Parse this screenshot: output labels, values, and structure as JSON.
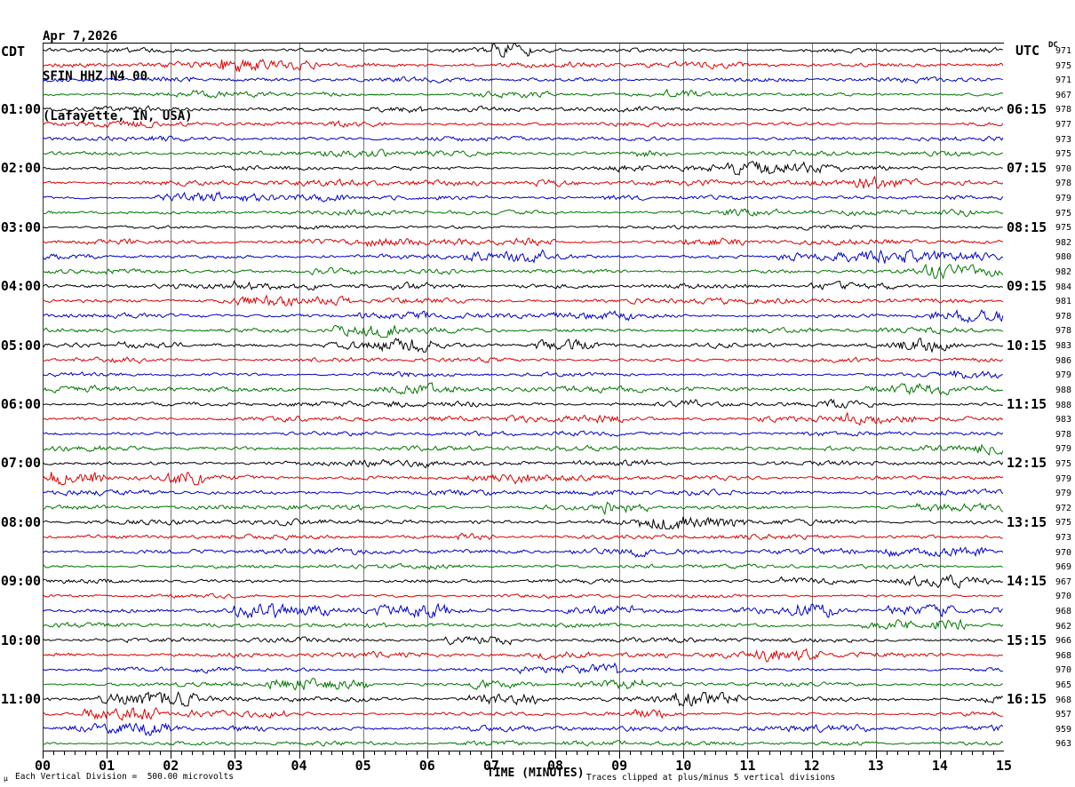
{
  "header": {
    "date_line": "Apr 7,2026",
    "station_line": "SFIN HHZ N4 00",
    "location_line": "(Lafayette, IN, USA)"
  },
  "axis_labels": {
    "left_tz": "CDT",
    "right_tz": "UTC",
    "dc": "DC",
    "x_title": "TIME (MINUTES)"
  },
  "left_times": [
    "01:00",
    "02:00",
    "03:00",
    "04:00",
    "05:00",
    "06:00",
    "07:00",
    "08:00",
    "09:00",
    "10:00",
    "11:00"
  ],
  "right_times": [
    "06:15",
    "07:15",
    "08:15",
    "09:15",
    "10:15",
    "11:15",
    "12:15",
    "13:15",
    "14:15",
    "15:15",
    "16:15"
  ],
  "x_ticks": [
    "00",
    "01",
    "02",
    "03",
    "04",
    "05",
    "06",
    "07",
    "08",
    "09",
    "10",
    "11",
    "12",
    "13",
    "14",
    "15"
  ],
  "dc_values": [
    971,
    975,
    971,
    967,
    978,
    977,
    973,
    975,
    970,
    978,
    979,
    975,
    975,
    982,
    980,
    982,
    984,
    981,
    978,
    978,
    983,
    986,
    979,
    988,
    988,
    983,
    978,
    979,
    975,
    979,
    979,
    972,
    975,
    973,
    970,
    969,
    967,
    970,
    968,
    962,
    966,
    968,
    970,
    965,
    968,
    957,
    959,
    963
  ],
  "footer": {
    "micro_glyph": "µ",
    "scale_note": "Each Vertical Division =  500.00 microvolts",
    "clip_note": "Traces clipped at plus/minus 5 vertical divisions"
  },
  "colors": {
    "trace_cycle": [
      "#000000",
      "#dd0000",
      "#0000cc",
      "#007700"
    ],
    "grid": "#777777",
    "frame": "#303030",
    "text": "#000000"
  },
  "chart_data": {
    "type": "line",
    "subtype": "helicorder-seismogram",
    "title": "SFIN HHZ N4 00 (Lafayette, IN, USA) Apr 7,2026",
    "xlabel": "TIME (MINUTES)",
    "x_range_minutes": [
      0,
      15
    ],
    "minutes_per_row": 15,
    "rows": 48,
    "rows_per_hour": 4,
    "minor_ticks_per_minute": 6,
    "grid": "vertical gray line at each minute, 00 through 15",
    "trace_color_cycle": [
      "black",
      "red",
      "blue",
      "green"
    ],
    "left_axis_timezone": "CDT",
    "left_axis_hour_labels": [
      "01:00",
      "02:00",
      "03:00",
      "04:00",
      "05:00",
      "06:00",
      "07:00",
      "08:00",
      "09:00",
      "10:00",
      "11:00"
    ],
    "right_axis_timezone": "UTC",
    "right_axis_hour_labels": [
      "06:15",
      "07:15",
      "08:15",
      "09:15",
      "10:15",
      "11:15",
      "12:15",
      "13:15",
      "14:15",
      "15:15",
      "16:15"
    ],
    "dc_offsets_per_row": [
      971,
      975,
      971,
      967,
      978,
      977,
      973,
      975,
      970,
      978,
      979,
      975,
      975,
      982,
      980,
      982,
      984,
      981,
      978,
      978,
      983,
      986,
      979,
      988,
      988,
      983,
      978,
      979,
      975,
      979,
      979,
      972,
      975,
      973,
      970,
      969,
      967,
      970,
      968,
      962,
      966,
      968,
      970,
      965,
      968,
      957,
      959,
      963
    ],
    "vertical_scale": "Each Vertical Division = 500.00 microvolts",
    "clipping": "Traces clipped at plus/minus 5 vertical divisions",
    "waveform": "continuous background seismic noise on all 48 rows (pseudo-random reconstruction; no discrete events legible)",
    "legend_position": "none"
  }
}
